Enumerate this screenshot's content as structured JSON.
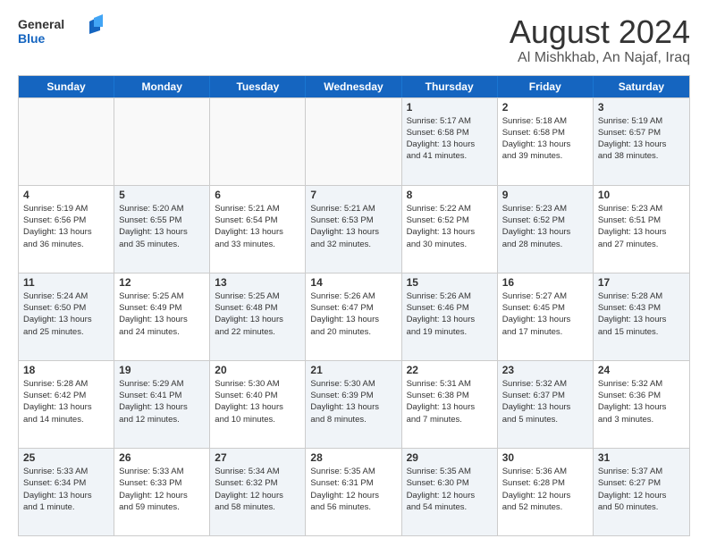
{
  "header": {
    "logo_line1": "General",
    "logo_line2": "Blue",
    "month": "August 2024",
    "location": "Al Mishkhab, An Najaf, Iraq"
  },
  "days": [
    "Sunday",
    "Monday",
    "Tuesday",
    "Wednesday",
    "Thursday",
    "Friday",
    "Saturday"
  ],
  "rows": [
    [
      {
        "day": "",
        "info": "",
        "empty": true
      },
      {
        "day": "",
        "info": "",
        "empty": true
      },
      {
        "day": "",
        "info": "",
        "empty": true
      },
      {
        "day": "",
        "info": "",
        "empty": true
      },
      {
        "day": "1",
        "info": "Sunrise: 5:17 AM\nSunset: 6:58 PM\nDaylight: 13 hours\nand 41 minutes."
      },
      {
        "day": "2",
        "info": "Sunrise: 5:18 AM\nSunset: 6:58 PM\nDaylight: 13 hours\nand 39 minutes."
      },
      {
        "day": "3",
        "info": "Sunrise: 5:19 AM\nSunset: 6:57 PM\nDaylight: 13 hours\nand 38 minutes."
      }
    ],
    [
      {
        "day": "4",
        "info": "Sunrise: 5:19 AM\nSunset: 6:56 PM\nDaylight: 13 hours\nand 36 minutes."
      },
      {
        "day": "5",
        "info": "Sunrise: 5:20 AM\nSunset: 6:55 PM\nDaylight: 13 hours\nand 35 minutes."
      },
      {
        "day": "6",
        "info": "Sunrise: 5:21 AM\nSunset: 6:54 PM\nDaylight: 13 hours\nand 33 minutes."
      },
      {
        "day": "7",
        "info": "Sunrise: 5:21 AM\nSunset: 6:53 PM\nDaylight: 13 hours\nand 32 minutes."
      },
      {
        "day": "8",
        "info": "Sunrise: 5:22 AM\nSunset: 6:52 PM\nDaylight: 13 hours\nand 30 minutes."
      },
      {
        "day": "9",
        "info": "Sunrise: 5:23 AM\nSunset: 6:52 PM\nDaylight: 13 hours\nand 28 minutes."
      },
      {
        "day": "10",
        "info": "Sunrise: 5:23 AM\nSunset: 6:51 PM\nDaylight: 13 hours\nand 27 minutes."
      }
    ],
    [
      {
        "day": "11",
        "info": "Sunrise: 5:24 AM\nSunset: 6:50 PM\nDaylight: 13 hours\nand 25 minutes."
      },
      {
        "day": "12",
        "info": "Sunrise: 5:25 AM\nSunset: 6:49 PM\nDaylight: 13 hours\nand 24 minutes."
      },
      {
        "day": "13",
        "info": "Sunrise: 5:25 AM\nSunset: 6:48 PM\nDaylight: 13 hours\nand 22 minutes."
      },
      {
        "day": "14",
        "info": "Sunrise: 5:26 AM\nSunset: 6:47 PM\nDaylight: 13 hours\nand 20 minutes."
      },
      {
        "day": "15",
        "info": "Sunrise: 5:26 AM\nSunset: 6:46 PM\nDaylight: 13 hours\nand 19 minutes."
      },
      {
        "day": "16",
        "info": "Sunrise: 5:27 AM\nSunset: 6:45 PM\nDaylight: 13 hours\nand 17 minutes."
      },
      {
        "day": "17",
        "info": "Sunrise: 5:28 AM\nSunset: 6:43 PM\nDaylight: 13 hours\nand 15 minutes."
      }
    ],
    [
      {
        "day": "18",
        "info": "Sunrise: 5:28 AM\nSunset: 6:42 PM\nDaylight: 13 hours\nand 14 minutes."
      },
      {
        "day": "19",
        "info": "Sunrise: 5:29 AM\nSunset: 6:41 PM\nDaylight: 13 hours\nand 12 minutes."
      },
      {
        "day": "20",
        "info": "Sunrise: 5:30 AM\nSunset: 6:40 PM\nDaylight: 13 hours\nand 10 minutes."
      },
      {
        "day": "21",
        "info": "Sunrise: 5:30 AM\nSunset: 6:39 PM\nDaylight: 13 hours\nand 8 minutes."
      },
      {
        "day": "22",
        "info": "Sunrise: 5:31 AM\nSunset: 6:38 PM\nDaylight: 13 hours\nand 7 minutes."
      },
      {
        "day": "23",
        "info": "Sunrise: 5:32 AM\nSunset: 6:37 PM\nDaylight: 13 hours\nand 5 minutes."
      },
      {
        "day": "24",
        "info": "Sunrise: 5:32 AM\nSunset: 6:36 PM\nDaylight: 13 hours\nand 3 minutes."
      }
    ],
    [
      {
        "day": "25",
        "info": "Sunrise: 5:33 AM\nSunset: 6:34 PM\nDaylight: 13 hours\nand 1 minute."
      },
      {
        "day": "26",
        "info": "Sunrise: 5:33 AM\nSunset: 6:33 PM\nDaylight: 12 hours\nand 59 minutes."
      },
      {
        "day": "27",
        "info": "Sunrise: 5:34 AM\nSunset: 6:32 PM\nDaylight: 12 hours\nand 58 minutes."
      },
      {
        "day": "28",
        "info": "Sunrise: 5:35 AM\nSunset: 6:31 PM\nDaylight: 12 hours\nand 56 minutes."
      },
      {
        "day": "29",
        "info": "Sunrise: 5:35 AM\nSunset: 6:30 PM\nDaylight: 12 hours\nand 54 minutes."
      },
      {
        "day": "30",
        "info": "Sunrise: 5:36 AM\nSunset: 6:28 PM\nDaylight: 12 hours\nand 52 minutes."
      },
      {
        "day": "31",
        "info": "Sunrise: 5:37 AM\nSunset: 6:27 PM\nDaylight: 12 hours\nand 50 minutes."
      }
    ]
  ]
}
